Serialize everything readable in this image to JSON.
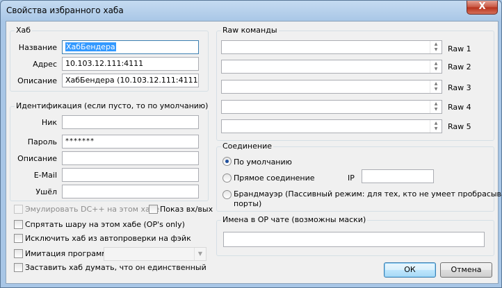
{
  "window": {
    "title": "Свойства избранного хаба",
    "close_label": "X"
  },
  "hub": {
    "legend": "Хаб",
    "name_label": "Название",
    "name_value": "ХабБендера",
    "address_label": "Адрес",
    "address_value": "10.103.12.111:4111",
    "desc_label": "Описание",
    "desc_value": "ХабБендера (10.103.12.111:4111)"
  },
  "identification": {
    "legend": "Идентификация (если пусто, то по умолчанию)",
    "nick_label": "Ник",
    "nick_value": "",
    "password_label": "Пароль",
    "password_value": "*******",
    "description_label": "Описание",
    "description_value": "",
    "email_label": "E-Mail",
    "email_value": "",
    "away_label": "Ушёл",
    "away_value": ""
  },
  "options": {
    "emulate_dc": "Эмулировать DC++ на этом хабе",
    "show_joins": "Показ вх/вых",
    "hide_share": "Спрятать шару на этом хабе (OP's only)",
    "exclude_autocheck": "Исключить хаб из автопроверки на фэйк",
    "imitation": "Имитация программы",
    "imitation_value": "",
    "only_hub": "Заставить хаб думать, что он единственный"
  },
  "raw": {
    "legend": "Raw команды",
    "items": [
      {
        "label": "Raw 1",
        "value": ""
      },
      {
        "label": "Raw 2",
        "value": ""
      },
      {
        "label": "Raw 3",
        "value": ""
      },
      {
        "label": "Raw 4",
        "value": ""
      },
      {
        "label": "Raw 5",
        "value": ""
      }
    ]
  },
  "connection": {
    "legend": "Соединение",
    "default": "По умолчанию",
    "direct": "Прямое соединение",
    "ip_label": "IP",
    "ip_value": "",
    "firewall_line1": "Брандмауэр (Пассивный режим: для тех, кто не умеет пробрасывать",
    "firewall_line2": "порты)",
    "selected": "default"
  },
  "op_chat": {
    "legend": "Имена в OP чате (возможны маски)",
    "value": ""
  },
  "buttons": {
    "ok": "ОК",
    "cancel": "Отмена"
  }
}
